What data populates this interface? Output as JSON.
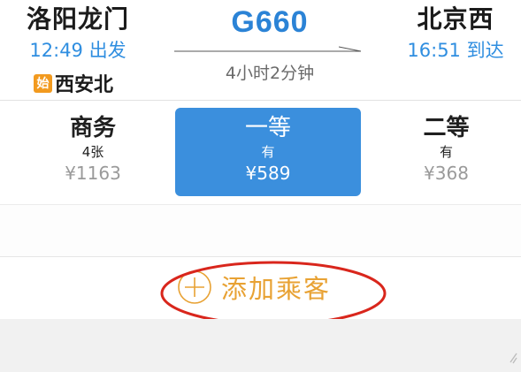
{
  "trip": {
    "from_station": "洛阳龙门",
    "depart_time": "12:49 出发",
    "origin_badge": "始",
    "origin_station": "西安北",
    "train_no": "G660",
    "duration": "4小时2分钟",
    "to_station": "北京西",
    "arrive_time": "16:51 到达"
  },
  "seats": [
    {
      "name": "商务",
      "availability": "4张",
      "price": "¥1163",
      "selected": false
    },
    {
      "name": "一等",
      "availability": "有",
      "price": "¥589",
      "selected": true
    },
    {
      "name": "二等",
      "availability": "有",
      "price": "¥368",
      "selected": false
    }
  ],
  "actions": {
    "add_passenger": "添加乘客"
  },
  "colors": {
    "accent_blue": "#2b83d6",
    "selected_seat": "#3b8fdd",
    "add_label": "#e8a234",
    "origin_badge": "#f29a1f",
    "highlight_ring": "#d9261c"
  },
  "icons": [
    "plus-circle-icon",
    "arrow-right-icon"
  ]
}
